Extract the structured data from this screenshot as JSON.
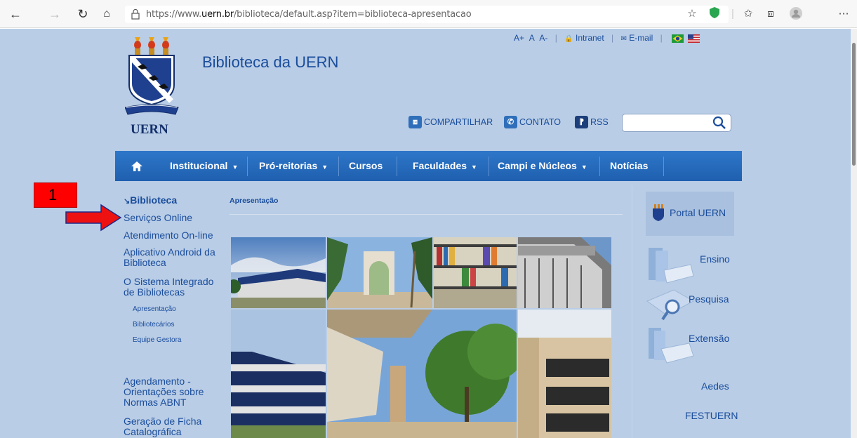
{
  "browser": {
    "url_prefix": "https://www.",
    "url_domain": "uern.br",
    "url_path": "/biblioteca/default.asp?item=biblioteca-apresentacao"
  },
  "header": {
    "site_title": "Biblioteca da UERN",
    "logo_text": "UERN",
    "font_controls": [
      "A+",
      "A",
      "A-"
    ],
    "intranet_label": "Intranet",
    "email_label": "E-mail"
  },
  "share": {
    "share_label": "COMPARTILHAR",
    "contact_label": "CONTATO",
    "rss_label": "RSS"
  },
  "search": {
    "placeholder": ""
  },
  "menu": {
    "items": [
      {
        "label": "Institucional",
        "dropdown": true
      },
      {
        "label": "Pró-reitorias",
        "dropdown": true
      },
      {
        "label": "Cursos",
        "dropdown": false
      },
      {
        "label": "Faculdades",
        "dropdown": true
      },
      {
        "label": "Campi e Núcleos",
        "dropdown": true
      },
      {
        "label": "Notícias",
        "dropdown": false
      }
    ]
  },
  "sidebar": {
    "heading": "Biblioteca",
    "items": [
      "Serviços Online",
      "Atendimento On-line",
      "Aplicativo Android da Biblioteca",
      "O Sistema Integrado de Bibliotecas"
    ],
    "subitems": [
      "Apresentação",
      "Bibliotecários",
      "Equipe Gestora"
    ],
    "more_items": [
      "Agendamento - Orientações sobre Normas ABNT",
      "Geração de Ficha Catalográfica"
    ]
  },
  "content": {
    "heading": "Apresentação"
  },
  "callout": {
    "number": "1"
  },
  "right": {
    "portal_label": "Portal UERN",
    "links": [
      "Ensino",
      "Pesquisa",
      "Extensão",
      "Aedes",
      "FESTUERN"
    ]
  },
  "colors": {
    "page_bg": "#b9cde6",
    "brand_blue": "#1a4d9c",
    "menu_blue": "#2468bb",
    "callout_red": "#ff0000"
  }
}
